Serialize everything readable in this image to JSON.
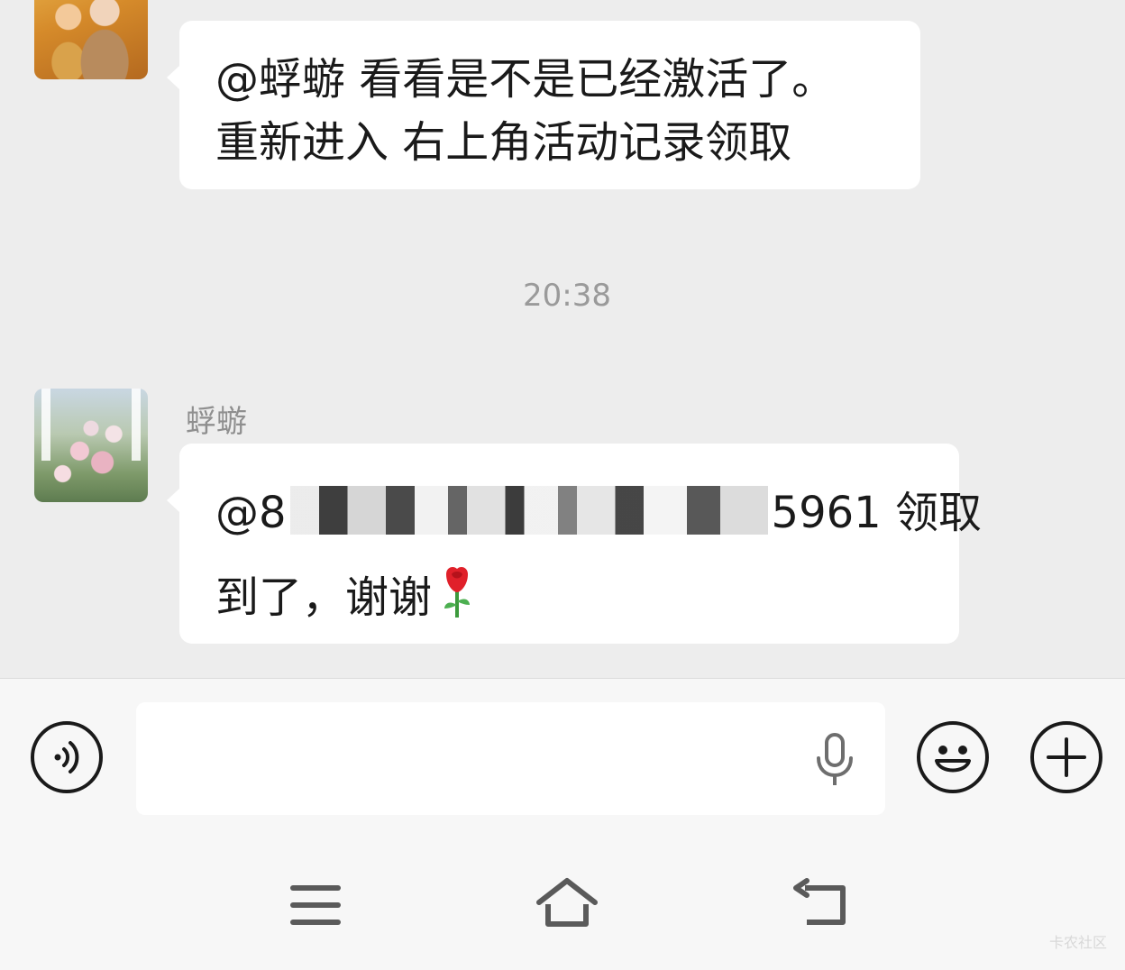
{
  "messages": [
    {
      "sender": "",
      "text_lines": [
        "@蜉蝣  看看是不是已经激活了。",
        "重新进入 右上角活动记录领取"
      ]
    },
    {
      "sender": "蜉蝣",
      "mention_prefix": "@8",
      "mention_suffix": "5961 领取",
      "line2": "到了，谢谢",
      "emoji": "rose-emoji"
    }
  ],
  "timestamp": "20:38",
  "input_bar": {
    "placeholder": "",
    "value": "",
    "voice_icon": "voice-icon",
    "mic_icon": "microphone-icon",
    "emoji_icon": "smiley-icon",
    "more_icon": "plus-icon"
  },
  "nav_bar": {
    "menu_icon": "menu-icon",
    "home_icon": "home-icon",
    "back_icon": "back-icon"
  },
  "watermark": "卡农社区"
}
